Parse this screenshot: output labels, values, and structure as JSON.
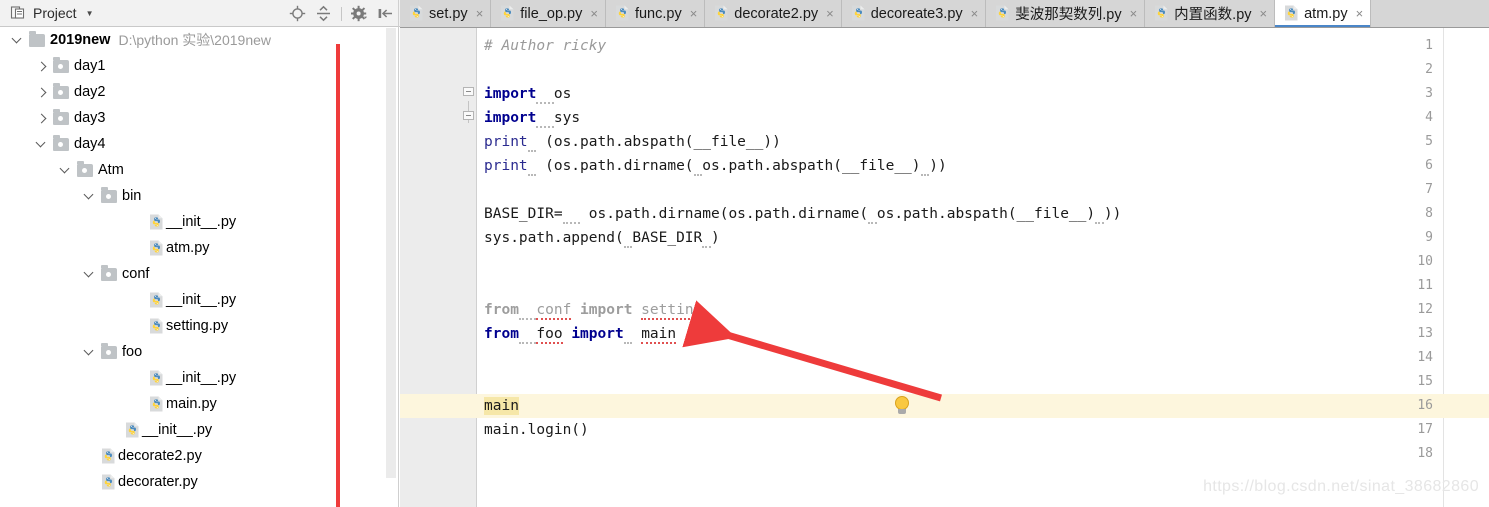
{
  "project_panel": {
    "title": "Project",
    "title_icon": "project-view-icon",
    "caret_icon": "chevron-down-icon",
    "tools": [
      {
        "name": "locate-icon",
        "label": "Select Opened File"
      },
      {
        "name": "collapse-all-icon",
        "label": "Collapse All"
      },
      {
        "name": "gear-icon",
        "label": "Settings"
      },
      {
        "name": "hide-panel-icon",
        "label": "Hide"
      }
    ],
    "tree": [
      {
        "indent": 0,
        "twisty": "down",
        "icon": "folder-icon",
        "label": "2019new",
        "bold": true,
        "path": "D:\\python 实验\\2019new"
      },
      {
        "indent": 1,
        "twisty": "right",
        "icon": "folder-icon",
        "label": "day1",
        "bold": false,
        "path": ""
      },
      {
        "indent": 1,
        "twisty": "right",
        "icon": "folder-icon",
        "label": "day2",
        "bold": false,
        "path": ""
      },
      {
        "indent": 1,
        "twisty": "right",
        "icon": "folder-icon",
        "label": "day3",
        "bold": false,
        "path": ""
      },
      {
        "indent": 1,
        "twisty": "down",
        "icon": "folder-icon",
        "label": "day4",
        "bold": false,
        "path": ""
      },
      {
        "indent": 2,
        "twisty": "down",
        "icon": "folder-icon",
        "label": "Atm",
        "bold": false,
        "path": ""
      },
      {
        "indent": 3,
        "twisty": "down",
        "icon": "folder-icon",
        "label": "bin",
        "bold": false,
        "path": ""
      },
      {
        "indent": 5,
        "twisty": "none",
        "icon": "python-file-icon",
        "label": "__init__.py",
        "bold": false,
        "path": ""
      },
      {
        "indent": 5,
        "twisty": "none",
        "icon": "python-file-icon",
        "label": "atm.py",
        "bold": false,
        "path": ""
      },
      {
        "indent": 3,
        "twisty": "down",
        "icon": "folder-icon",
        "label": "conf",
        "bold": false,
        "path": ""
      },
      {
        "indent": 5,
        "twisty": "none",
        "icon": "python-file-icon",
        "label": "__init__.py",
        "bold": false,
        "path": ""
      },
      {
        "indent": 5,
        "twisty": "none",
        "icon": "python-file-icon",
        "label": "setting.py",
        "bold": false,
        "path": ""
      },
      {
        "indent": 3,
        "twisty": "down",
        "icon": "folder-icon",
        "label": "foo",
        "bold": false,
        "path": ""
      },
      {
        "indent": 5,
        "twisty": "none",
        "icon": "python-file-icon",
        "label": "__init__.py",
        "bold": false,
        "path": ""
      },
      {
        "indent": 5,
        "twisty": "none",
        "icon": "python-file-icon",
        "label": "main.py",
        "bold": false,
        "path": ""
      },
      {
        "indent": 4,
        "twisty": "none",
        "icon": "python-file-icon",
        "label": "__init__.py",
        "bold": false,
        "path": ""
      },
      {
        "indent": 3,
        "twisty": "none",
        "icon": "python-file-icon",
        "label": "decorate2.py",
        "bold": false,
        "path": ""
      },
      {
        "indent": 3,
        "twisty": "none",
        "icon": "python-file-icon",
        "label": "decorater.py",
        "bold": false,
        "path": ""
      }
    ]
  },
  "tabs": [
    {
      "label": "set.py",
      "active": false,
      "icon": "python-file-icon",
      "close": "×"
    },
    {
      "label": "file_op.py",
      "active": false,
      "icon": "python-file-icon",
      "close": "×"
    },
    {
      "label": "func.py",
      "active": false,
      "icon": "python-file-icon",
      "close": "×"
    },
    {
      "label": "decorate2.py",
      "active": false,
      "icon": "python-file-icon",
      "close": "×"
    },
    {
      "label": "decoreate3.py",
      "active": false,
      "icon": "python-file-icon",
      "close": "×"
    },
    {
      "label": "斐波那契数列.py",
      "active": false,
      "icon": "python-file-icon",
      "close": "×"
    },
    {
      "label": "内置函数.py",
      "active": false,
      "icon": "python-file-icon",
      "close": "×"
    },
    {
      "label": "atm.py",
      "active": true,
      "icon": "python-file-icon",
      "close": "×"
    }
  ],
  "editor": {
    "line_numbers": [
      "1",
      "2",
      "3",
      "4",
      "5",
      "6",
      "7",
      "8",
      "9",
      "10",
      "11",
      "12",
      "13",
      "14",
      "15",
      "16",
      "17",
      "18"
    ],
    "highlighted_line": "16",
    "lines": [
      {
        "n": "1",
        "text": "# Author ricky"
      },
      {
        "n": "2",
        "text": ""
      },
      {
        "n": "3",
        "text": "import os"
      },
      {
        "n": "4",
        "text": "import sys"
      },
      {
        "n": "5",
        "text": "print (os.path.abspath(__file__))"
      },
      {
        "n": "6",
        "text": "print (os.path.dirname( os.path.abspath(__file__) ))"
      },
      {
        "n": "7",
        "text": ""
      },
      {
        "n": "8",
        "text": "BASE_DIR=  os.path.dirname(os.path.dirname( os.path.abspath(__file__) ))"
      },
      {
        "n": "9",
        "text": "sys.path.append( BASE_DIR )"
      },
      {
        "n": "10",
        "text": ""
      },
      {
        "n": "11",
        "text": ""
      },
      {
        "n": "12",
        "text": "from  conf import setting"
      },
      {
        "n": "13",
        "text": "from  foo import  main"
      },
      {
        "n": "14",
        "text": ""
      },
      {
        "n": "15",
        "text": ""
      },
      {
        "n": "16",
        "text": "main"
      },
      {
        "n": "17",
        "text": "main.login()"
      },
      {
        "n": "18",
        "text": ""
      }
    ],
    "bulb_icon": "intention-bulb-icon",
    "fold_markers": [
      "3",
      "4"
    ]
  },
  "annotations": {
    "vertical_line_color": "#ef3b3b",
    "arrow_color": "#ee3b3b",
    "arrow_from": "940,397",
    "arrow_to": "688,322"
  },
  "watermark": "https://blog.csdn.net/sinat_38682860"
}
